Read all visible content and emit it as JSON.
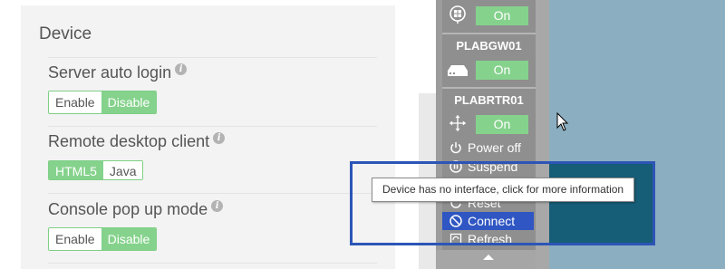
{
  "settings": {
    "section_title": "Device",
    "server_auto_login": {
      "label": "Server auto login",
      "options": [
        "Enable",
        "Disable"
      ],
      "selected": "Disable"
    },
    "remote_desktop_client": {
      "label": "Remote desktop client",
      "options": [
        "HTML5",
        "Java"
      ],
      "selected": "HTML5"
    },
    "console_popup_mode": {
      "label": "Console pop up mode",
      "options": [
        "Enable",
        "Disable"
      ],
      "selected": "Disable"
    },
    "info_icon_glyph": "i"
  },
  "devices": [
    {
      "name": "",
      "icon": "windows-host-icon",
      "state": "On"
    },
    {
      "name": "PLABGW01",
      "icon": "gateway-icon",
      "state": "On"
    },
    {
      "name": "PLABRTR01",
      "icon": "router-icon",
      "state": "On"
    }
  ],
  "menu": {
    "power_off": "Power off",
    "suspend": "Suspend",
    "reset": "Reset",
    "connect": "Connect",
    "refresh": "Refresh"
  },
  "tooltip": {
    "text": "Device has no interface, click for more information"
  },
  "colors": {
    "accent_green": "#85d28c",
    "highlight_blue": "#2c55b7",
    "canvas": "#8baec0",
    "canvas_dark": "#165d77"
  }
}
